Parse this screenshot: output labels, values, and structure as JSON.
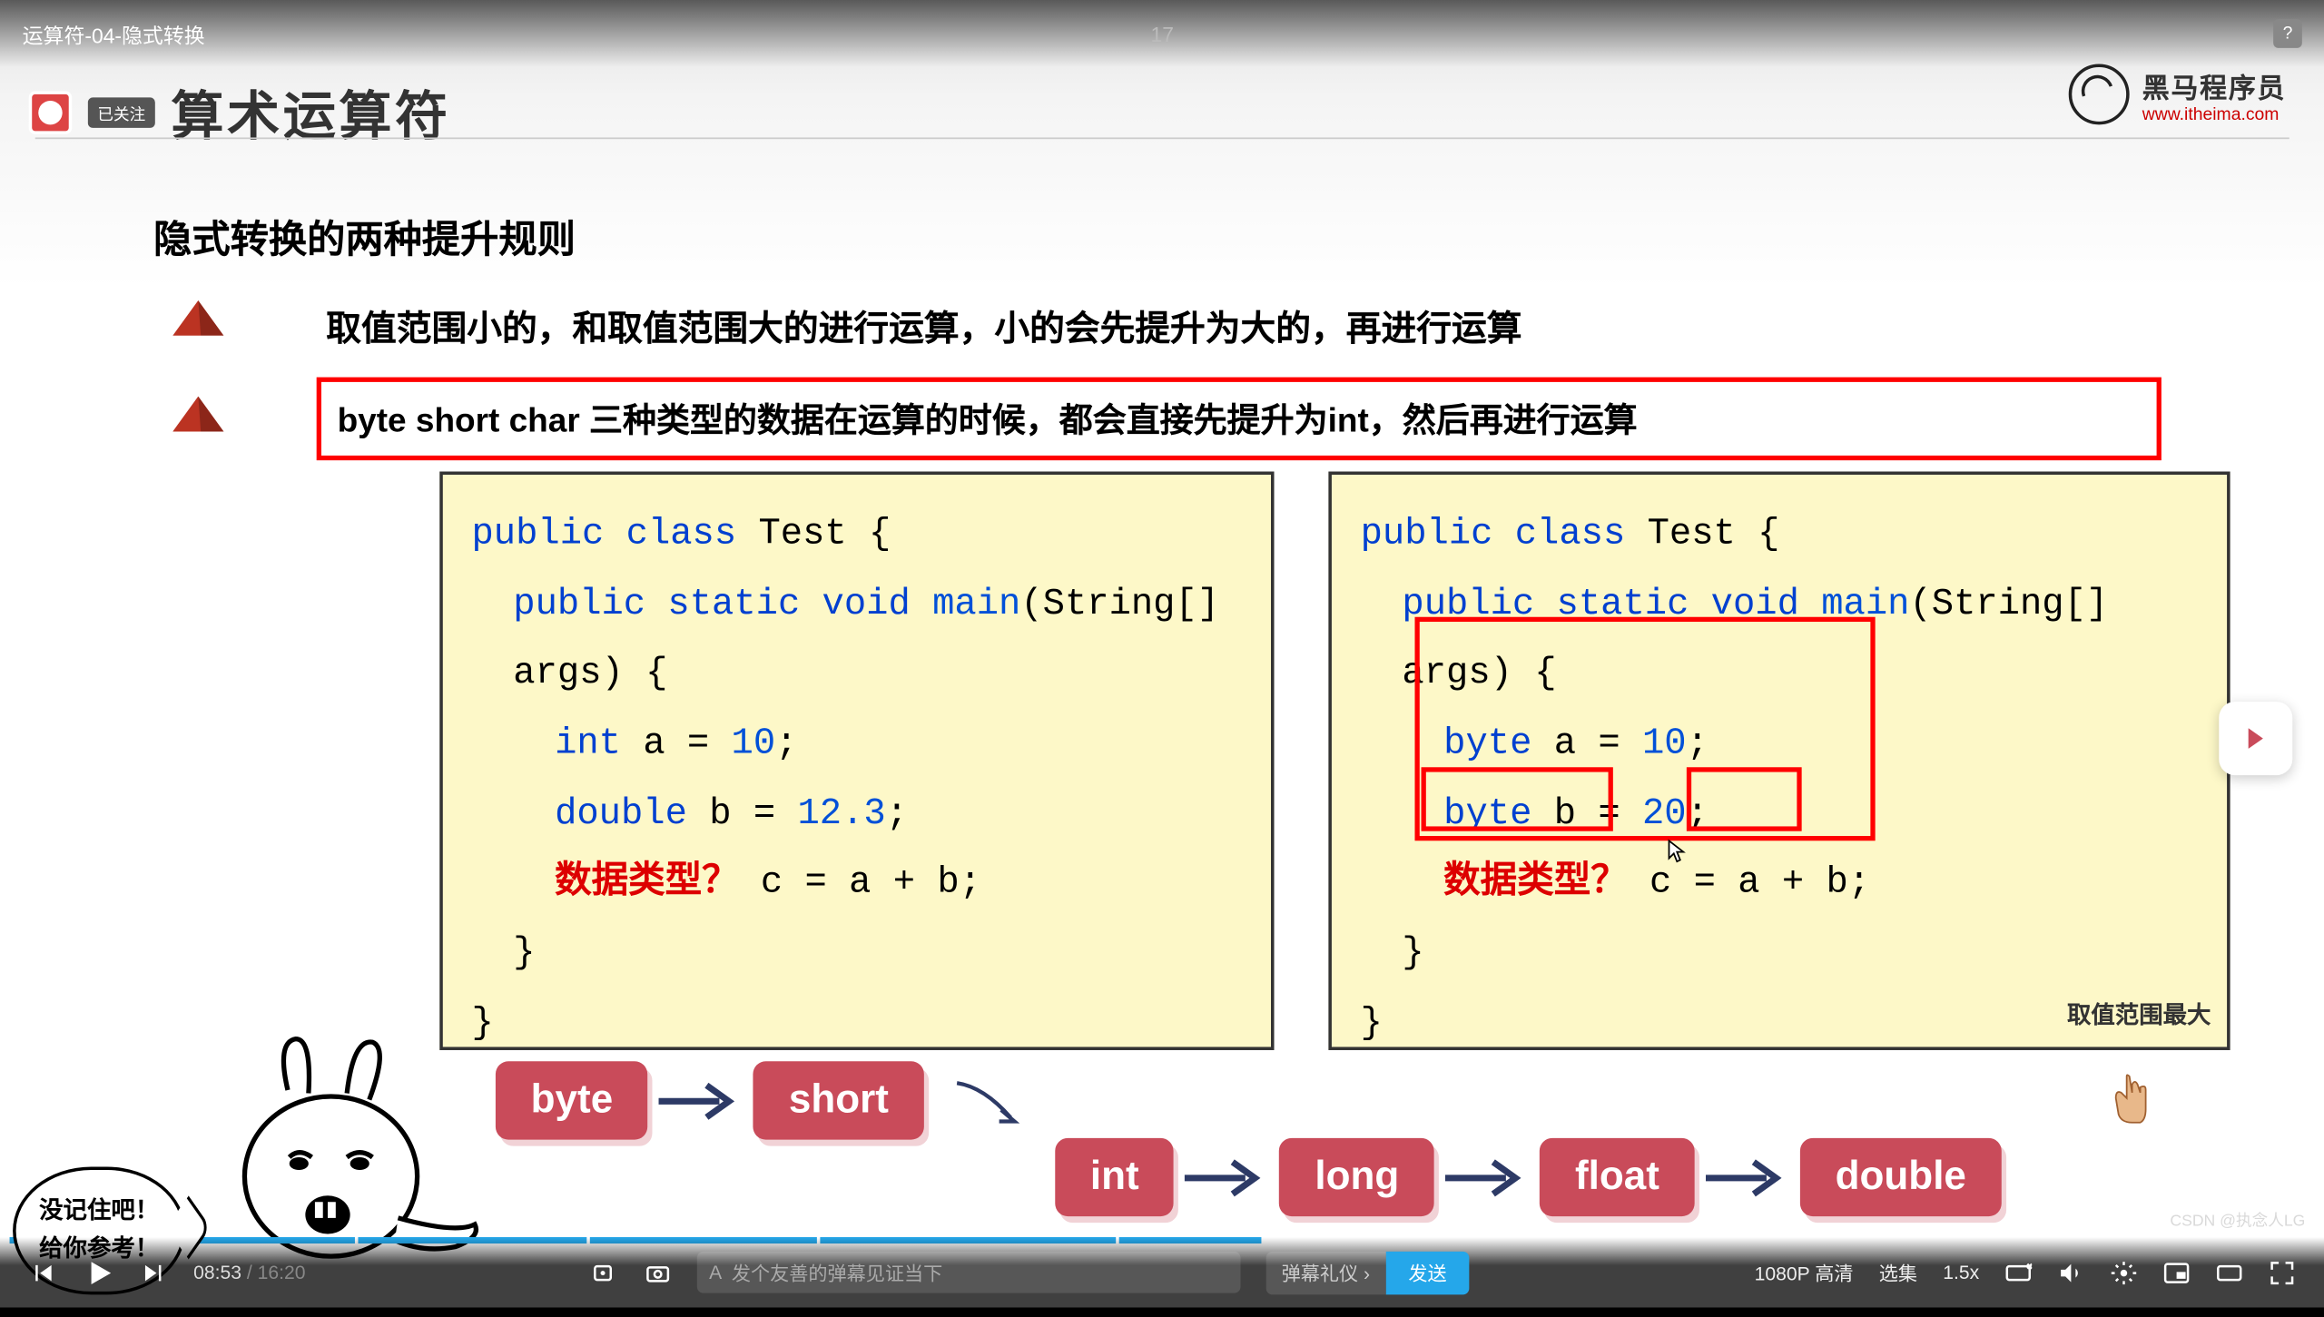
{
  "top": {
    "title": "运算符-04-隐式转换",
    "page": "17",
    "help": "?"
  },
  "slide": {
    "followed": "已关注",
    "title": "算术运算符",
    "brand_cn": "黑马程序员",
    "brand_en": "www.itheima.com",
    "subtitle": "隐式转换的两种提升规则",
    "rule1": "取值范围小的，和取值范围大的进行运算，小的会先提升为大的，再进行运算",
    "rule2": "byte short char 三种类型的数据在运算的时候，都会直接先提升为int，然后再进行运算",
    "code_left": {
      "l1": "public class",
      "l1b": " Test {",
      "l2": "public static void",
      "l2b": " main",
      "l2c": "(String[] args) {",
      "l3a": "int",
      "l3b": " a = ",
      "l3c": "10",
      "l3d": ";",
      "l4a": "double",
      "l4b": " b = ",
      "l4c": "12.3",
      "l4d": ";",
      "l5a": "数据类型？",
      "l5b": " c = a + b;",
      "l6": "}",
      "l7": "}"
    },
    "code_right": {
      "l1": "public class",
      "l1b": " Test {",
      "l2": "public static void",
      "l2b": " main",
      "l2c": "(String[] args) {",
      "l3a": "byte",
      "l3b": " a = ",
      "l3c": "10",
      "l3d": ";",
      "l4a": "byte",
      "l4b": " b = ",
      "l4c": "20",
      "l4d": ";",
      "l5a": "数据类型？",
      "l5b": "  c = ",
      "l5c": "a + b;",
      "l6": "}",
      "l7": "}",
      "note": "取值范围最大"
    },
    "flow": [
      "byte",
      "short",
      "int",
      "long",
      "float",
      "double"
    ],
    "bubble_l1": "没记住吧！",
    "bubble_l2": "给你参考！"
  },
  "ctrl": {
    "cur": "08:53",
    "dur": "16:20",
    "ph": "发个友善的弹幕见证当下",
    "eti": "弹幕礼仪",
    "send": "发送",
    "quality": "1080P 高清",
    "episodes": "选集",
    "speed": "1.5x"
  },
  "watermark": "CSDN @执念人LG"
}
